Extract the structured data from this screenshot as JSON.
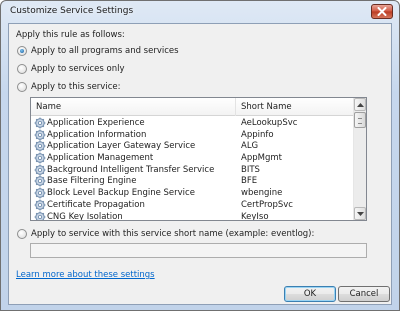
{
  "window": {
    "title": "Customize Service Settings"
  },
  "dialog": {
    "intro_label": "Apply this rule as follows:",
    "options": {
      "all_programs": "Apply to all programs and services",
      "services_only": "Apply to services only",
      "this_service": "Apply to this service:",
      "short_name": "Apply to service with this service short name (example: eventlog):"
    },
    "selected_option": "all_programs",
    "short_name_value": "",
    "learn_more_link": "Learn more about these settings",
    "ok_label": "OK",
    "cancel_label": "Cancel"
  },
  "services": {
    "columns": {
      "name": "Name",
      "short_name": "Short Name"
    },
    "rows": [
      {
        "name": "Application Experience",
        "short": "AeLookupSvc"
      },
      {
        "name": "Application Information",
        "short": "Appinfo"
      },
      {
        "name": "Application Layer Gateway Service",
        "short": "ALG"
      },
      {
        "name": "Application Management",
        "short": "AppMgmt"
      },
      {
        "name": "Background Intelligent Transfer Service",
        "short": "BITS"
      },
      {
        "name": "Base Filtering Engine",
        "short": "BFE"
      },
      {
        "name": "Block Level Backup Engine Service",
        "short": "wbengine"
      },
      {
        "name": "Certificate Propagation",
        "short": "CertPropSvc"
      },
      {
        "name": "CNG Key Isolation",
        "short": "KeyIso"
      }
    ]
  },
  "icons": {
    "service": "gear-service-icon",
    "close": "close-icon",
    "scroll_up": "arrow-up-icon",
    "scroll_down": "arrow-down-icon"
  },
  "colors": {
    "title_gradient": "#c6d7ed",
    "close_button": "#d0563f",
    "link": "#0066cc",
    "dialog_bg": "#f0f0f0"
  }
}
